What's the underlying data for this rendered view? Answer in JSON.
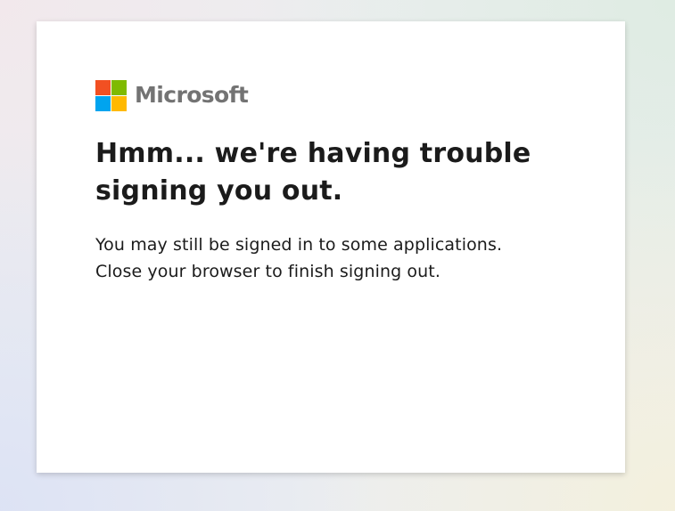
{
  "brand": {
    "name": "Microsoft",
    "logo_colors": [
      "#f25022",
      "#7fba00",
      "#00a4ef",
      "#ffb900"
    ],
    "word_color": "#737373"
  },
  "heading": "Hmm... we're having trouble signing you out.",
  "message": {
    "line1": "You may still be signed in to some applications.",
    "line2": "Close your browser to finish signing out."
  }
}
